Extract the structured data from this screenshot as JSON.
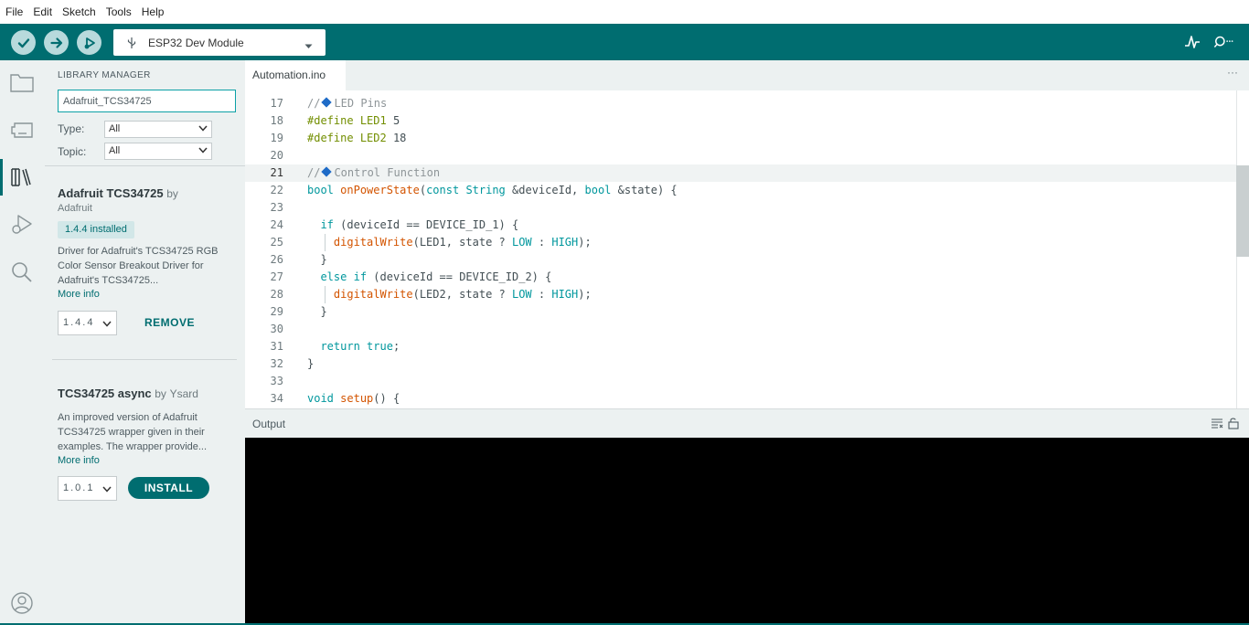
{
  "menu": [
    "File",
    "Edit",
    "Sketch",
    "Tools",
    "Help"
  ],
  "toolbar": {
    "board": "ESP32 Dev Module",
    "buttons": [
      "verify-icon",
      "upload-icon",
      "debug-icon"
    ],
    "right_icons": [
      "serial-plotter-icon",
      "serial-monitor-icon"
    ],
    "accent": "#006d70"
  },
  "sidebar": {
    "title": "LIBRARY MANAGER",
    "search_value": "Adafruit_TCS34725",
    "type_label": "Type:",
    "type_value": "All",
    "topic_label": "Topic:",
    "topic_value": "All",
    "libraries": [
      {
        "name": "Adafruit TCS34725",
        "by": "by",
        "author": "Adafruit",
        "badge": "1.4.4 installed",
        "desc": "Driver for Adafruit's TCS34725 RGB Color Sensor Breakout Driver for Adafruit's TCS34725...",
        "more": "More info",
        "version": "1.4.4",
        "action": "REMOVE"
      },
      {
        "name": "TCS34725 async",
        "by": "by",
        "author": "Ysard",
        "desc": "An improved version of Adafruit TCS34725 wrapper given in their examples. The wrapper provide...",
        "more": "More info",
        "version": "1.0.1",
        "action": "INSTALL"
      }
    ]
  },
  "editor": {
    "tab": "Automation.ino",
    "more": "···",
    "current_line": "21",
    "lines": [
      {
        "n": "17",
        "text": "// ◆ LED Pins"
      },
      {
        "n": "18",
        "text": "#define LED1 5"
      },
      {
        "n": "19",
        "text": "#define LED2 18"
      },
      {
        "n": "20",
        "text": ""
      },
      {
        "n": "21",
        "text": "// ◆ Control Function"
      },
      {
        "n": "22",
        "text": "bool onPowerState(const String &deviceId, bool &state) {"
      },
      {
        "n": "23",
        "text": ""
      },
      {
        "n": "24",
        "text": "  if (deviceId == DEVICE_ID_1) {"
      },
      {
        "n": "25",
        "text": "    digitalWrite(LED1, state ? LOW : HIGH);"
      },
      {
        "n": "26",
        "text": "  }"
      },
      {
        "n": "27",
        "text": "  else if (deviceId == DEVICE_ID_2) {"
      },
      {
        "n": "28",
        "text": "    digitalWrite(LED2, state ? LOW : HIGH);"
      },
      {
        "n": "29",
        "text": "  }"
      },
      {
        "n": "30",
        "text": ""
      },
      {
        "n": "31",
        "text": "  return true;"
      },
      {
        "n": "32",
        "text": "}"
      },
      {
        "n": "33",
        "text": ""
      },
      {
        "n": "34",
        "text": "void setup() {"
      }
    ]
  },
  "output": {
    "title": "Output"
  }
}
